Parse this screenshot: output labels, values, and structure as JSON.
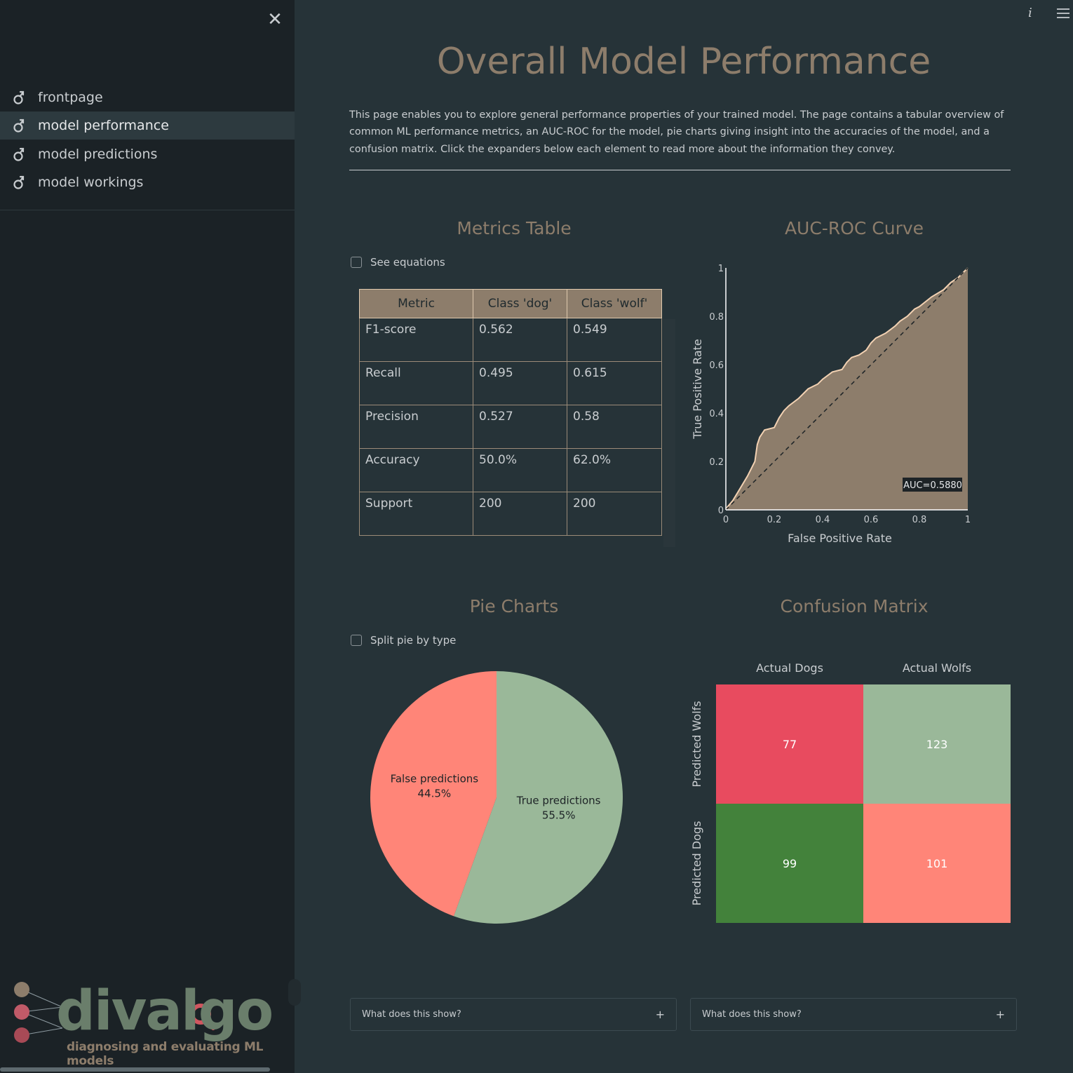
{
  "sidebar": {
    "close_icon": "close-icon",
    "items": [
      {
        "label": "frontpage",
        "icon": "male-symbol-icon",
        "active": false
      },
      {
        "label": "model performance",
        "icon": "male-symbol-icon",
        "active": true
      },
      {
        "label": "model predictions",
        "icon": "male-symbol-icon",
        "active": false
      },
      {
        "label": "model workings",
        "icon": "male-symbol-icon",
        "active": false
      }
    ],
    "logo": {
      "text": "divalgo",
      "tagline": "diagnosing and evaluating ML models"
    }
  },
  "header": {
    "info_icon": "info-icon",
    "menu_icon": "hamburger-menu-icon"
  },
  "main": {
    "title": "Overall Model Performance",
    "description": "This page enables you to explore general performance properties of your trained model. The page contains a tabular overview of common ML performance metrics, an AUC-ROC for the model, pie charts giving insight into the accuracies of the model, and a confusion matrix. Click the expanders below each element to read more about the information they convey.",
    "metrics_section": {
      "title": "Metrics Table",
      "checkbox_label": "See equations",
      "headers": [
        "Metric",
        "Class 'dog'",
        "Class 'wolf'"
      ],
      "rows": [
        [
          "F1-score",
          "0.562",
          "0.549"
        ],
        [
          "Recall",
          "0.495",
          "0.615"
        ],
        [
          "Precision",
          "0.527",
          "0.58"
        ],
        [
          "Accuracy",
          "50.0%",
          "62.0%"
        ],
        [
          "Support",
          "200",
          "200"
        ]
      ]
    },
    "roc_section": {
      "title": "AUC-ROC Curve"
    },
    "pie_section": {
      "title": "Pie Charts",
      "checkbox_label": "Split pie by type"
    },
    "confusion_section": {
      "title": "Confusion Matrix"
    },
    "expanders": [
      {
        "label": "What does this show?"
      },
      {
        "label": "What does this show?"
      }
    ]
  },
  "colors": {
    "accent": "#8d7d6b",
    "roc_fill": "#8d7d6b",
    "roc_line": "#f3d2b3",
    "cm_red": "#e84b5f",
    "cm_sage": "#9ab899",
    "cm_green": "#43823b",
    "cm_salmon": "#ff8578",
    "pie_false": "#ff8578",
    "pie_true": "#9ab899"
  },
  "chart_data": [
    {
      "type": "area",
      "title": "",
      "xlabel": "False Positive Rate",
      "ylabel": "True Positive Rate",
      "xlim": [
        0,
        1
      ],
      "ylim": [
        0,
        1
      ],
      "xticks": [
        "0",
        "0.2",
        "0.4",
        "0.6",
        "0.8",
        "1"
      ],
      "yticks": [
        "0",
        "0.2",
        "0.4",
        "0.6",
        "0.8",
        "1"
      ],
      "annotation": "AUC=0.5880",
      "series": [
        {
          "x": [
            0,
            0.005,
            0.03,
            0.06,
            0.09,
            0.12,
            0.13,
            0.14,
            0.16,
            0.2,
            0.22,
            0.24,
            0.26,
            0.3,
            0.34,
            0.36,
            0.38,
            0.4,
            0.44,
            0.48,
            0.5,
            0.52,
            0.55,
            0.58,
            0.6,
            0.62,
            0.64,
            0.66,
            0.7,
            0.72,
            0.75,
            0.78,
            0.8,
            0.85,
            0.9,
            0.93,
            0.96,
            1
          ],
          "y": [
            0,
            0.01,
            0.04,
            0.09,
            0.14,
            0.2,
            0.27,
            0.3,
            0.33,
            0.34,
            0.38,
            0.41,
            0.43,
            0.46,
            0.5,
            0.51,
            0.52,
            0.54,
            0.57,
            0.58,
            0.61,
            0.63,
            0.64,
            0.66,
            0.69,
            0.71,
            0.72,
            0.73,
            0.76,
            0.78,
            0.8,
            0.83,
            0.84,
            0.88,
            0.91,
            0.94,
            0.96,
            1
          ]
        },
        {
          "x": [
            0,
            1
          ],
          "y": [
            0,
            1
          ]
        }
      ]
    },
    {
      "type": "pie",
      "title": "",
      "labels": [
        "False predictions",
        "True predictions"
      ],
      "values": [
        44.5,
        55.5
      ],
      "display": [
        "44.5%",
        "55.5%"
      ]
    },
    {
      "type": "heatmap",
      "title": "",
      "x": [
        "Actual Dogs",
        "Actual Wolfs"
      ],
      "y": [
        "Predicted Wolfs",
        "Predicted Dogs"
      ],
      "z": [
        [
          77,
          123
        ],
        [
          99,
          101
        ]
      ]
    }
  ]
}
